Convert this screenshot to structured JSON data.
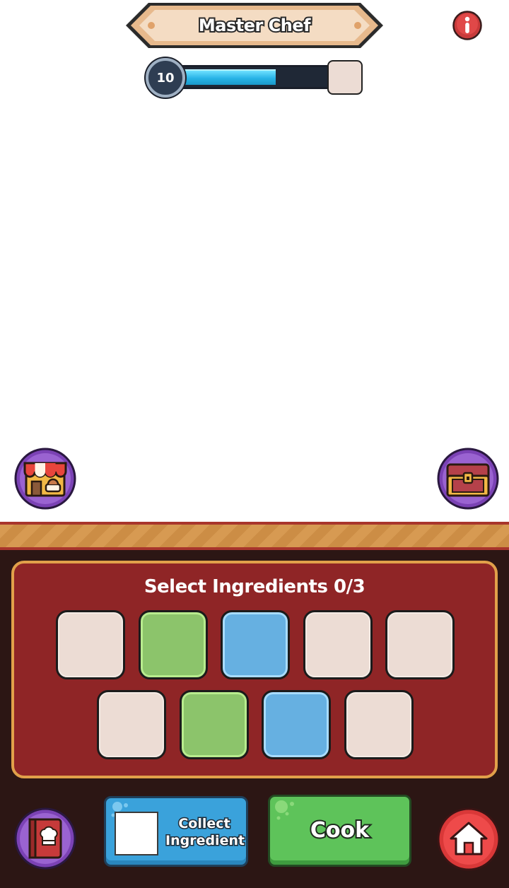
{
  "header": {
    "title": "Master Chef",
    "info_icon": "info-icon"
  },
  "player": {
    "level": "10",
    "xp_progress": 0.62
  },
  "side_buttons": {
    "shop_icon": "shop-icon",
    "chest_icon": "treasure-chest-icon",
    "recipe_book_icon": "recipe-book-icon",
    "home_icon": "home-icon"
  },
  "ingredients": {
    "title": "Select Ingredients 0/3",
    "slots": [
      {
        "color": "beige"
      },
      {
        "color": "green"
      },
      {
        "color": "blue"
      },
      {
        "color": "beige"
      },
      {
        "color": "beige"
      },
      {
        "color": "beige"
      },
      {
        "color": "green"
      },
      {
        "color": "blue"
      },
      {
        "color": "beige"
      }
    ]
  },
  "actions": {
    "collect_label": "Collect\nIngredient",
    "cook_label": "Cook"
  },
  "colors": {
    "panel_red": "#8f2526",
    "panel_border": "#e1a04a",
    "ingredient_green": "#8cc46b",
    "ingredient_blue": "#66b0e1",
    "ingredient_beige": "#ecdcd4",
    "cook_green": "#5ec35a",
    "collect_blue": "#3aa2db",
    "xp_blue": "#27b3e6"
  }
}
